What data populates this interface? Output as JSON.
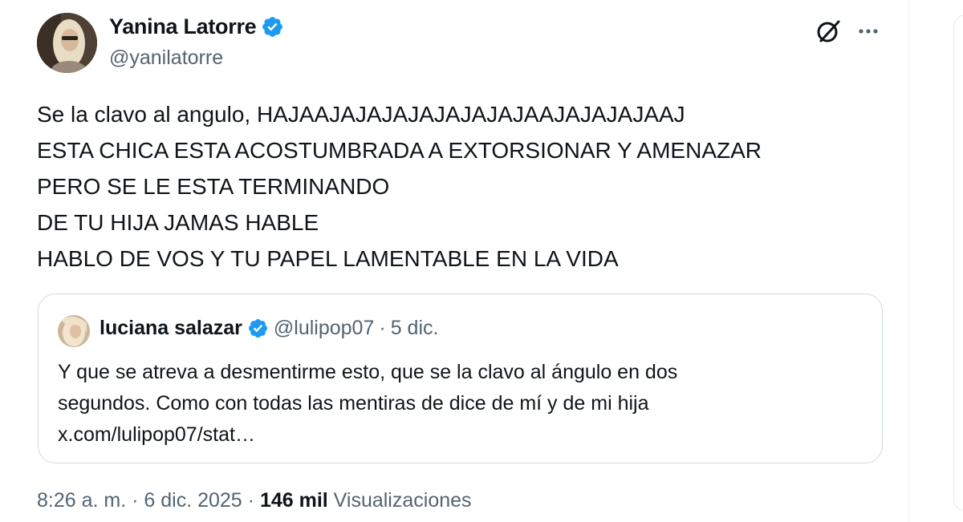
{
  "author": {
    "name": "Yanina Latorre",
    "handle": "@yanilatorre"
  },
  "icons": {
    "grok": "grok-icon",
    "more": "more-icon",
    "verified": "verified-badge-icon"
  },
  "colors": {
    "verified": "#1d9bf0",
    "secondary_text": "#536471",
    "primary_text": "#0f1419",
    "border": "#cfd9de"
  },
  "tweet": {
    "lines": [
      "Se la clavo al angulo, HAJAAJAJAJAJAJAJAJAJAAJAJAJAJAAJ",
      "ESTA CHICA ESTA ACOSTUMBRADA A EXTORSIONAR Y AMENAZAR",
      "PERO SE LE ESTA TERMINANDO",
      "DE TU HIJA JAMAS HABLE",
      "HABLO DE VOS Y TU PAPEL LAMENTABLE EN LA VIDA"
    ]
  },
  "quote": {
    "name": "luciana salazar",
    "handle": "@lulipop07",
    "separator": "·",
    "date": "5 dic.",
    "lines": [
      "Y que se atreva a desmentirme esto, que se la clavo al ángulo en dos",
      "segundos. Como con todas las mentiras de dice de mí y de mi hija",
      "x.com/lulipop07/stat…"
    ]
  },
  "meta": {
    "time": "8:26 a. m.",
    "separator1": " · ",
    "date": "6 dic. 2025",
    "separator2": " · ",
    "views_count": "146 mil",
    "views_label": "Visualizaciones"
  }
}
